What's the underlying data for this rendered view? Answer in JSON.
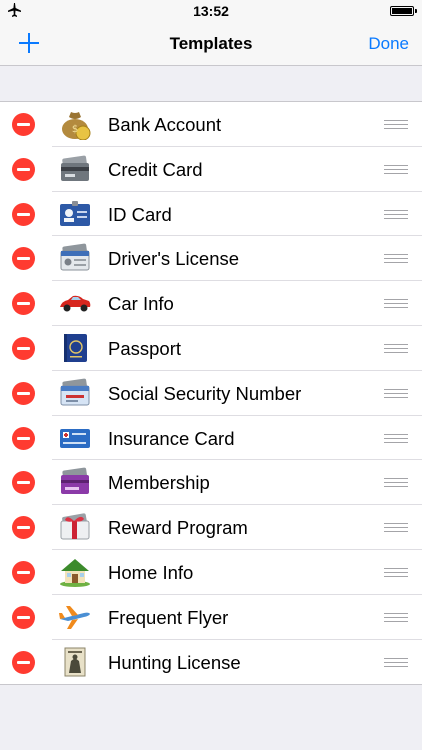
{
  "status_bar": {
    "time": "13:52"
  },
  "nav": {
    "title": "Templates",
    "done_label": "Done"
  },
  "templates": [
    {
      "label": "Bank Account",
      "icon": "money-bag-icon"
    },
    {
      "label": "Credit Card",
      "icon": "credit-card-icon"
    },
    {
      "label": "ID Card",
      "icon": "id-card-icon"
    },
    {
      "label": "Driver's License",
      "icon": "drivers-license-icon"
    },
    {
      "label": "Car Info",
      "icon": "car-icon"
    },
    {
      "label": "Passport",
      "icon": "passport-icon"
    },
    {
      "label": "Social Security Number",
      "icon": "social-security-card-icon"
    },
    {
      "label": "Insurance Card",
      "icon": "insurance-card-icon"
    },
    {
      "label": "Membership",
      "icon": "membership-card-icon"
    },
    {
      "label": "Reward Program",
      "icon": "gift-card-icon"
    },
    {
      "label": "Home Info",
      "icon": "house-icon"
    },
    {
      "label": "Frequent Flyer",
      "icon": "airplane-icon"
    },
    {
      "label": "Hunting License",
      "icon": "hunting-license-icon"
    }
  ],
  "colors": {
    "accent": "#0a7aff",
    "delete": "#ff3b30",
    "background": "#efeff4"
  }
}
